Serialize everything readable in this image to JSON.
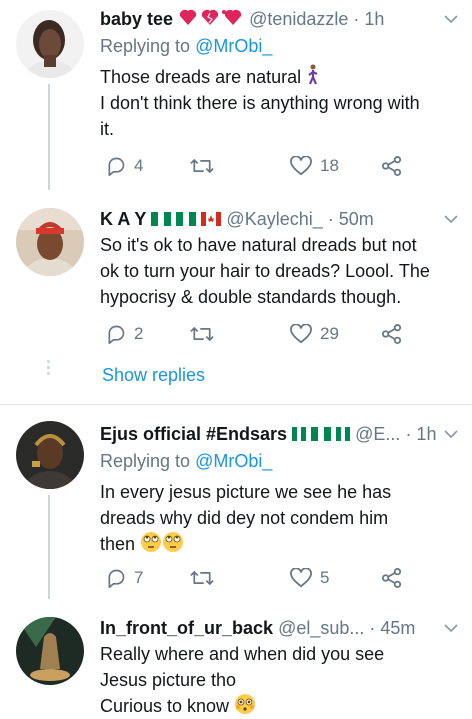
{
  "tweets": [
    {
      "name": "baby tee",
      "handle": "@tenidazzle",
      "time": "· 1h",
      "replying_prefix": "Replying to",
      "replying_to": "@MrObi_",
      "lines": [
        "Those dreads are natural",
        "I don't think there is anything wrong with",
        "it."
      ],
      "replies": "4",
      "retweets": "",
      "likes": "18"
    },
    {
      "name": "K A Y",
      "handle": "@Kaylechi_",
      "time": "· 50m",
      "lines": [
        "So it's ok to have natural dreads but not",
        "ok to turn your hair to dreads? Loool. The",
        "hypocrisy & double standards though."
      ],
      "replies": "2",
      "retweets": "",
      "likes": "29",
      "show_replies": "Show replies"
    },
    {
      "name": "Ejus official #Endsars",
      "handle": "@E...",
      "time": "· 1h",
      "replying_prefix": "Replying to",
      "replying_to": "@MrObi_",
      "lines": [
        "In every jesus picture we see he has",
        "dreads why did dey not condem him",
        "then"
      ],
      "replies": "7",
      "retweets": "",
      "likes": "5"
    },
    {
      "name": "In_front_of_ur_back",
      "handle": "@el_sub...",
      "time": "· 45m",
      "lines": [
        "Really where and when did you see",
        "Jesus picture tho",
        "Curious to know"
      ]
    }
  ],
  "colors": {
    "text": "#14171a",
    "secondary": "#657786",
    "link": "#1b95e0",
    "heart": "#e0245e"
  },
  "icons": [
    "reply-icon",
    "retweet-icon",
    "like-icon",
    "share-icon",
    "chevron-down-icon",
    "heart-emoji-icon",
    "flag-nigeria-icon",
    "flag-canada-icon",
    "eye-roll-emoji-icon",
    "flushed-emoji-icon",
    "walking-emoji-icon"
  ]
}
